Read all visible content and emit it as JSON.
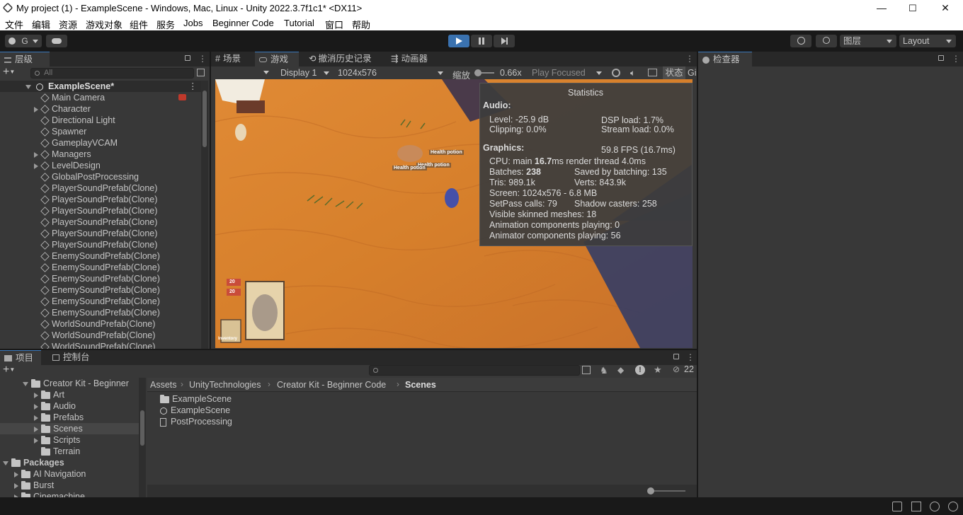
{
  "window": {
    "title": "My project (1) - ExampleScene - Windows, Mac, Linux - Unity 2022.3.7f1c1* <DX11>",
    "minimize": "—",
    "maximize": "☐",
    "close": "✕"
  },
  "menu": [
    "文件",
    "编辑",
    "资源",
    "游戏对象",
    "组件",
    "服务",
    "Jobs",
    "Beginner Code",
    "Tutorial",
    "窗口",
    "帮助"
  ],
  "toolbar": {
    "account": "G",
    "layers_label": "图层",
    "layout_label": "Layout"
  },
  "hierarchy": {
    "tab": "层级",
    "search_placeholder": "All",
    "scene": "ExampleScene*",
    "items": [
      {
        "label": "Main Camera",
        "expand": false
      },
      {
        "label": "Character",
        "expand": true
      },
      {
        "label": "Directional Light",
        "expand": false
      },
      {
        "label": "Spawner",
        "expand": false
      },
      {
        "label": "GameplayVCAM",
        "expand": false
      },
      {
        "label": "Managers",
        "expand": true
      },
      {
        "label": "LevelDesign",
        "expand": true
      },
      {
        "label": "GlobalPostProcessing",
        "expand": false
      },
      {
        "label": "PlayerSoundPrefab(Clone)",
        "expand": false
      },
      {
        "label": "PlayerSoundPrefab(Clone)",
        "expand": false
      },
      {
        "label": "PlayerSoundPrefab(Clone)",
        "expand": false
      },
      {
        "label": "PlayerSoundPrefab(Clone)",
        "expand": false
      },
      {
        "label": "PlayerSoundPrefab(Clone)",
        "expand": false
      },
      {
        "label": "PlayerSoundPrefab(Clone)",
        "expand": false
      },
      {
        "label": "EnemySoundPrefab(Clone)",
        "expand": false
      },
      {
        "label": "EnemySoundPrefab(Clone)",
        "expand": false
      },
      {
        "label": "EnemySoundPrefab(Clone)",
        "expand": false
      },
      {
        "label": "EnemySoundPrefab(Clone)",
        "expand": false
      },
      {
        "label": "EnemySoundPrefab(Clone)",
        "expand": false
      },
      {
        "label": "EnemySoundPrefab(Clone)",
        "expand": false
      },
      {
        "label": "WorldSoundPrefab(Clone)",
        "expand": false
      },
      {
        "label": "WorldSoundPrefab(Clone)",
        "expand": false
      },
      {
        "label": "WorldSoundPrefab(Clone)",
        "expand": false
      }
    ]
  },
  "center_tabs": [
    "场景",
    "游戏",
    "撤消历史记录",
    "动画器"
  ],
  "game": {
    "display": "Display 1",
    "resolution": "1024x576",
    "scale_label": "缩放",
    "scale_value": "0.66x",
    "play_mode": "Play Focused",
    "stats_btn": "状态",
    "gizmos": "Gi",
    "health_labels": [
      "Health potion",
      "Health potion",
      "Health potion"
    ],
    "card_numbers": [
      "20",
      "20"
    ],
    "inventory": "Inventory"
  },
  "stats": {
    "title": "Statistics",
    "audio_h": "Audio:",
    "level": "Level: -25.9 dB",
    "dsp": "DSP load: 1.7%",
    "clipping": "Clipping: 0.0%",
    "stream": "Stream load: 0.0%",
    "graphics_h": "Graphics:",
    "fps": "59.8 FPS (16.7ms)",
    "cpu_a": "CPU: main ",
    "cpu_b": "16.7",
    "cpu_c": "ms  render thread 4.0ms",
    "batches_a": "Batches: ",
    "batches_b": "238",
    "saved": "Saved by batching: 135",
    "tris": "Tris: 989.1k",
    "verts": "Verts: 843.9k",
    "screen": "Screen: 1024x576 - 6.8 MB",
    "setpass": "SetPass calls: 79",
    "shadow": "Shadow casters: 258",
    "skinned": "Visible skinned meshes: 18",
    "anim": "Animation components playing: 0",
    "animator": "Animator components playing: 56"
  },
  "inspector": {
    "tab": "检查器"
  },
  "project": {
    "tab_project": "项目",
    "tab_console": "控制台",
    "hidden_count": "22",
    "tree": [
      {
        "label": "Creator Kit - Beginner",
        "indent": 1,
        "open": true
      },
      {
        "label": "Art",
        "indent": 2,
        "open": false
      },
      {
        "label": "Audio",
        "indent": 2,
        "open": false
      },
      {
        "label": "Prefabs",
        "indent": 2,
        "open": false
      },
      {
        "label": "Scenes",
        "indent": 2,
        "open": false
      },
      {
        "label": "Scripts",
        "indent": 2,
        "open": false
      },
      {
        "label": "Terrain",
        "indent": 2,
        "open": false
      },
      {
        "label": "Packages",
        "indent": 0,
        "open": true
      },
      {
        "label": "AI Navigation",
        "indent": 1,
        "open": false
      },
      {
        "label": "Burst",
        "indent": 1,
        "open": false
      },
      {
        "label": "Cinemachine",
        "indent": 1,
        "open": false
      }
    ],
    "breadcrumb": [
      "Assets",
      "UnityTechnologies",
      "Creator Kit - Beginner Code",
      "Scenes"
    ],
    "files": [
      "ExampleScene",
      "ExampleScene",
      "PostProcessing"
    ]
  }
}
